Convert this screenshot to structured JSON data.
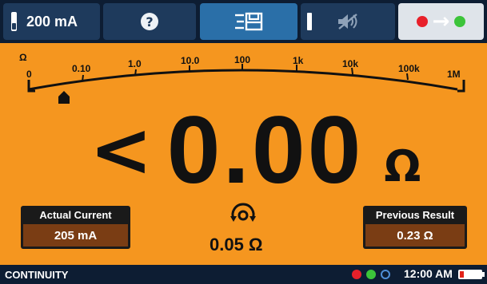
{
  "topbar": {
    "current_label": "200 mA",
    "help_glyph": "?",
    "menu_glyph": "☰",
    "sound_glyph": "🔇",
    "nav_arrow": "→",
    "nav_colors": {
      "left": "#e8202a",
      "right": "#3cc43a"
    }
  },
  "scale": {
    "unit_symbol": "Ω",
    "ticks": [
      "0",
      "0.10",
      "1.0",
      "10.0",
      "100",
      "1k",
      "10k",
      "100k",
      "1M"
    ],
    "pointer_position": 0.09
  },
  "reading": {
    "prefix": "<",
    "value": "0.00",
    "unit": "Ω"
  },
  "actual_current": {
    "title": "Actual Current",
    "value": "205 mA"
  },
  "previous_result": {
    "title": "Previous Result",
    "value": "0.23 Ω"
  },
  "null_offset": {
    "icon": "null-icon",
    "value": "0.05 Ω"
  },
  "status": {
    "mode": "CONTINUITY",
    "time": "12:00 AM",
    "indicator_colors": [
      "#e8202a",
      "#3cc43a",
      "#4f8fd8"
    ]
  }
}
